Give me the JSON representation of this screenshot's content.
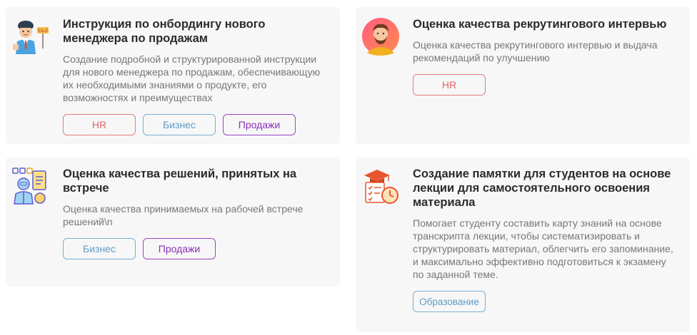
{
  "cards": [
    {
      "title": "Инструкция по онбордингу нового менеджера по продажам",
      "description": "Создание подробной и структурированной инструкции для нового менеджера по продажам, обеспечивающую их необходимыми знаниями о продукте, его возможностях и преимуществах",
      "icon": "sales-manager-icon",
      "tags": [
        "HR",
        "Бизнес",
        "Продажи"
      ]
    },
    {
      "title": "Оценка качества рекрутингового интервью",
      "description": "Оценка качества рекрутингового интервью и выдача рекомендаций по улучшению",
      "icon": "recruiter-avatar-icon",
      "tags": [
        "HR"
      ]
    },
    {
      "title": "Оценка качества решений, принятых на встрече",
      "description": "Оценка качества принимаемых на рабочей встрече решений\\n",
      "icon": "meeting-analyst-icon",
      "tags": [
        "Бизнес",
        "Продажи"
      ]
    },
    {
      "title": "Создание памятки для студентов на основе лекции для самостоятельного освоения материала",
      "description": "Помогает студенту составить карту знаний на основе транскрипта лекции, чтобы систематизировать и структурировать материал, облегчить его запоминание, и максимально эффективно подготовиться к экзамену по заданной теме.",
      "icon": "graduation-checklist-icon",
      "tags": [
        "Образование"
      ]
    }
  ],
  "colors": {
    "card_bg": "#f7f7f7",
    "hr": "#e06464",
    "business": "#5e9cc7",
    "sales": "#8b2fb8",
    "education": "#5e9cc7"
  }
}
